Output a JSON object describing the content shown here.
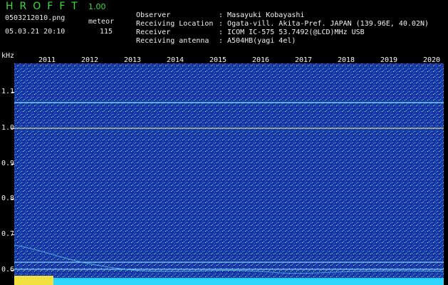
{
  "header": {
    "app_name": "HROFFT",
    "version": "1.00",
    "filename": "0503212010.png",
    "mode_label": "meteor",
    "timestamp": "05.03.21 20:10",
    "count": "115"
  },
  "info": [
    {
      "key": "Observer",
      "value": "Masayuki Kobayashi"
    },
    {
      "key": "Receiving Location",
      "value": "Ogata-vill. Akita-Pref. JAPAN (139.96E, 40.02N)"
    },
    {
      "key": "Receiver",
      "value": "ICOM IC-575 53.7492(@LCD)MHz USB"
    },
    {
      "key": "Receiving antenna",
      "value": "A504HB(yagi 4el)"
    }
  ],
  "yaxis": {
    "unit": "kHz",
    "ticks": [
      "1.1",
      "1.0",
      "0.9",
      "0.8",
      "0.7",
      "0.6"
    ]
  },
  "xaxis": {
    "ticks": [
      "2011",
      "2012",
      "2013",
      "2014",
      "2015",
      "2016",
      "2017",
      "2018",
      "2019",
      "2020"
    ]
  },
  "colors": {
    "background": "#000000",
    "spectrogram_base": "#1838a8",
    "trace_cyan": "#78f0f0",
    "trace_yellow": "#f0f070",
    "title_green": "#3ddc3d"
  }
}
